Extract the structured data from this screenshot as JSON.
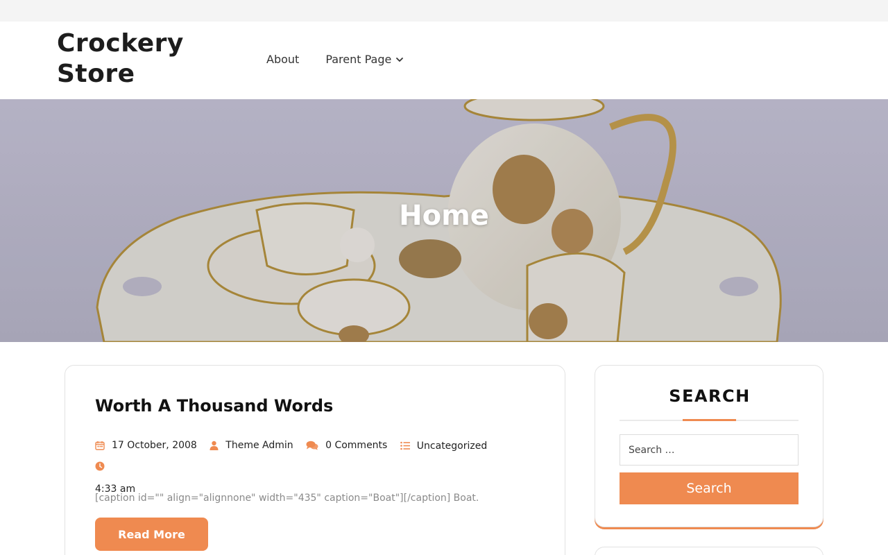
{
  "site": {
    "title": "Crockery Store"
  },
  "nav": {
    "items": [
      {
        "label": "About"
      },
      {
        "label": "Parent Page",
        "icon": "chevron-down-icon"
      }
    ]
  },
  "hero": {
    "title": "Home"
  },
  "post": {
    "title": "Worth A Thousand Words",
    "meta": {
      "date": "17 October, 2008",
      "author": "Theme Admin",
      "comments": "0 Comments",
      "category": "Uncategorized",
      "time": "4:33 am"
    },
    "excerpt": "[caption id=\"\" align=\"alignnone\" width=\"435\" caption=\"Boat\"][/caption] Boat.",
    "read_more_label": "Read More"
  },
  "sidebar": {
    "search_widget": {
      "title": "SEARCH",
      "placeholder": "Search …",
      "button_label": "Search"
    }
  },
  "colors": {
    "accent": "#ef8a50",
    "topbar": "#f4f4f4",
    "text": "#111111"
  },
  "icons": [
    "calendar-icon",
    "user-icon",
    "comments-icon",
    "list-icon",
    "clock-icon",
    "chevron-down-icon"
  ]
}
